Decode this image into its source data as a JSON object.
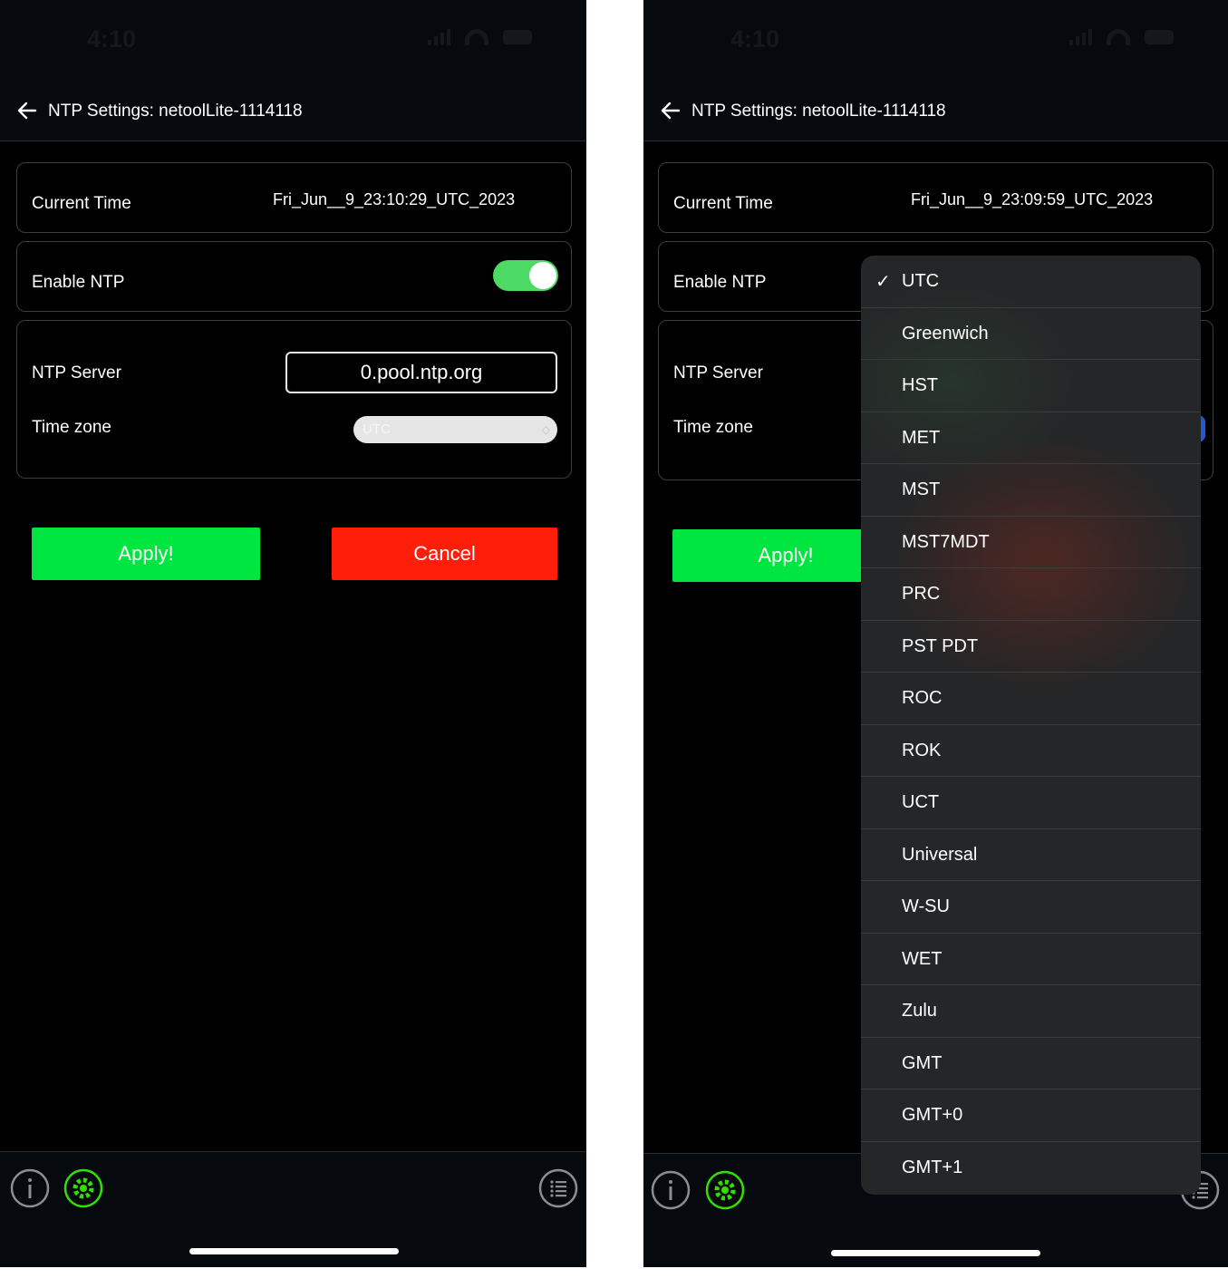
{
  "left": {
    "status_time": "4:10",
    "header_title": "NTP Settings: netoolLite-1114118",
    "current_time_label": "Current Time",
    "current_time_value": "Fri_Jun__9_23:10:29_UTC_2023",
    "enable_ntp_label": "Enable NTP",
    "enable_ntp_on": true,
    "ntp_server_label": "NTP Server",
    "ntp_server_value": "0.pool.ntp.org",
    "time_zone_label": "Time zone",
    "time_zone_value": "UTC",
    "apply_label": "Apply!",
    "cancel_label": "Cancel"
  },
  "right": {
    "status_time": "4:10",
    "header_title": "NTP Settings: netoolLite-1114118",
    "current_time_label": "Current Time",
    "current_time_value": "Fri_Jun__9_23:09:59_UTC_2023",
    "enable_ntp_label": "Enable NTP",
    "ntp_server_label": "NTP Server",
    "time_zone_label": "Time zone",
    "apply_label": "Apply!",
    "timezone_menu": {
      "selected": "UTC",
      "check_glyph": "✓",
      "options": [
        "UTC",
        "Greenwich",
        "HST",
        "MET",
        "MST",
        "MST7MDT",
        "PRC",
        "PST PDT",
        "ROC",
        "ROK",
        "UCT",
        "Universal",
        "W-SU",
        "WET",
        "Zulu",
        "GMT",
        "GMT+0",
        "GMT+1"
      ]
    }
  },
  "icons": {
    "back": "arrow-left-icon",
    "info": "info-icon",
    "settings": "gear-icon",
    "list": "list-icon"
  },
  "colors": {
    "apply": "#00e640",
    "cancel": "#ff1e0a",
    "toggle_on": "#4cd964",
    "settings_accent": "#32e000"
  }
}
